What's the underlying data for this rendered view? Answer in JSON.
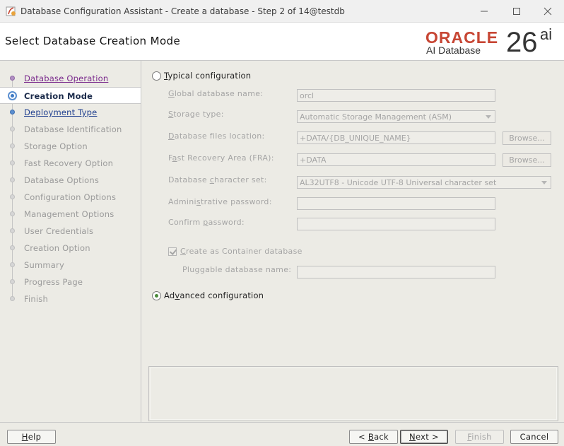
{
  "window": {
    "title": "Database Configuration Assistant - Create a database - Step 2 of 14@testdb"
  },
  "header": {
    "page_title": "Select Database Creation Mode",
    "brand_oracle": "ORACLE",
    "brand_product": "AI Database",
    "brand_version": "26",
    "brand_version_sup": "ai"
  },
  "nav": {
    "items": [
      {
        "label": "Database Operation",
        "state": "visited"
      },
      {
        "label": "Creation Mode",
        "state": "current"
      },
      {
        "label": "Deployment Type",
        "state": "next"
      },
      {
        "label": "Database Identification",
        "state": "pending"
      },
      {
        "label": "Storage Option",
        "state": "pending"
      },
      {
        "label": "Fast Recovery Option",
        "state": "pending"
      },
      {
        "label": "Database Options",
        "state": "pending"
      },
      {
        "label": "Configuration Options",
        "state": "pending"
      },
      {
        "label": "Management Options",
        "state": "pending"
      },
      {
        "label": "User Credentials",
        "state": "pending"
      },
      {
        "label": "Creation Option",
        "state": "pending"
      },
      {
        "label": "Summary",
        "state": "pending"
      },
      {
        "label": "Progress Page",
        "state": "pending"
      },
      {
        "label": "Finish",
        "state": "pending"
      }
    ]
  },
  "form": {
    "typical": {
      "label_mn": "T",
      "label_rest": "ypical configuration",
      "selected": false
    },
    "advanced": {
      "label_pre": "Ad",
      "label_mn": "v",
      "label_rest": "anced configuration",
      "selected": true
    },
    "global_db_name": {
      "label_mn": "G",
      "label_rest": "lobal database name:",
      "value": "orcl"
    },
    "storage_type": {
      "label_mn": "S",
      "label_rest": "torage type:",
      "value": "Automatic Storage Management (ASM)"
    },
    "db_files_location": {
      "label_mn": "D",
      "label_rest": "atabase files location:",
      "value": "+DATA/{DB_UNIQUE_NAME}"
    },
    "fra": {
      "label_pre": "F",
      "label_mn": "a",
      "label_rest": "st Recovery Area (FRA):",
      "value": "+DATA"
    },
    "charset": {
      "label_pre": "Database ",
      "label_mn": "c",
      "label_rest": "haracter set:",
      "value": "AL32UTF8 - Unicode UTF-8 Universal character set"
    },
    "admin_password": {
      "label_pre": "Admini",
      "label_mn": "s",
      "label_rest": "trative password:",
      "value": ""
    },
    "confirm_password": {
      "label_pre": "Confirm ",
      "label_mn": "p",
      "label_rest": "assword:",
      "value": ""
    },
    "container_db": {
      "label_mn": "C",
      "label_rest": "reate as Container database",
      "checked": true
    },
    "pdb_name": {
      "label": "Pluggable database name:",
      "value": ""
    },
    "browse_label": "Browse..."
  },
  "footer": {
    "help_mn": "H",
    "help_rest": "elp",
    "back_pre": "< ",
    "back_mn": "B",
    "back_rest": "ack",
    "next_mn": "N",
    "next_rest": "ext >",
    "finish_mn": "F",
    "finish_rest": "inish",
    "cancel": "Cancel"
  },
  "colors": {
    "oracle_red": "#c74634",
    "panel_bg": "#ecebe5",
    "visited_link": "#7a2a8c",
    "link": "#1f3f8f"
  }
}
